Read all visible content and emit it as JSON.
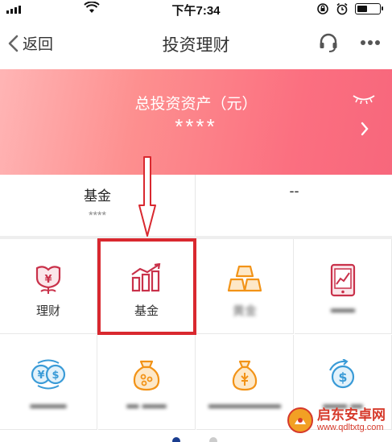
{
  "status_bar": {
    "time": "下午7:34",
    "battery_level": 0.45
  },
  "nav": {
    "back_label": "返回",
    "title": "投资理财"
  },
  "banner": {
    "title": "总投资资产（元）",
    "value": "****"
  },
  "summary": {
    "left_name": "基金",
    "left_value": "****",
    "right_name": "--"
  },
  "grid": {
    "tiles": [
      {
        "label": "理财",
        "icon": "flower-yen-icon"
      },
      {
        "label": "基金",
        "icon": "bar-chart-icon"
      },
      {
        "label": "黄金",
        "icon": "gold-bars-icon"
      },
      {
        "label": "",
        "icon": "tablet-chart-icon"
      },
      {
        "label": "",
        "icon": "currency-exchange-icon"
      },
      {
        "label": "",
        "icon": "money-bag-icon"
      },
      {
        "label": "",
        "icon": "money-sack-icon"
      },
      {
        "label": "",
        "icon": "dollar-coin-icon"
      }
    ]
  },
  "watermark": {
    "name": "启东安卓网",
    "url": "www.qdltxtg.com"
  },
  "colors": {
    "accent_red": "#d9282f",
    "icon_red": "#c9314a",
    "icon_orange": "#f29317",
    "icon_blue": "#3a9bd7",
    "pager_active": "#1a3d8f",
    "pager_inactive": "#cccccc"
  }
}
